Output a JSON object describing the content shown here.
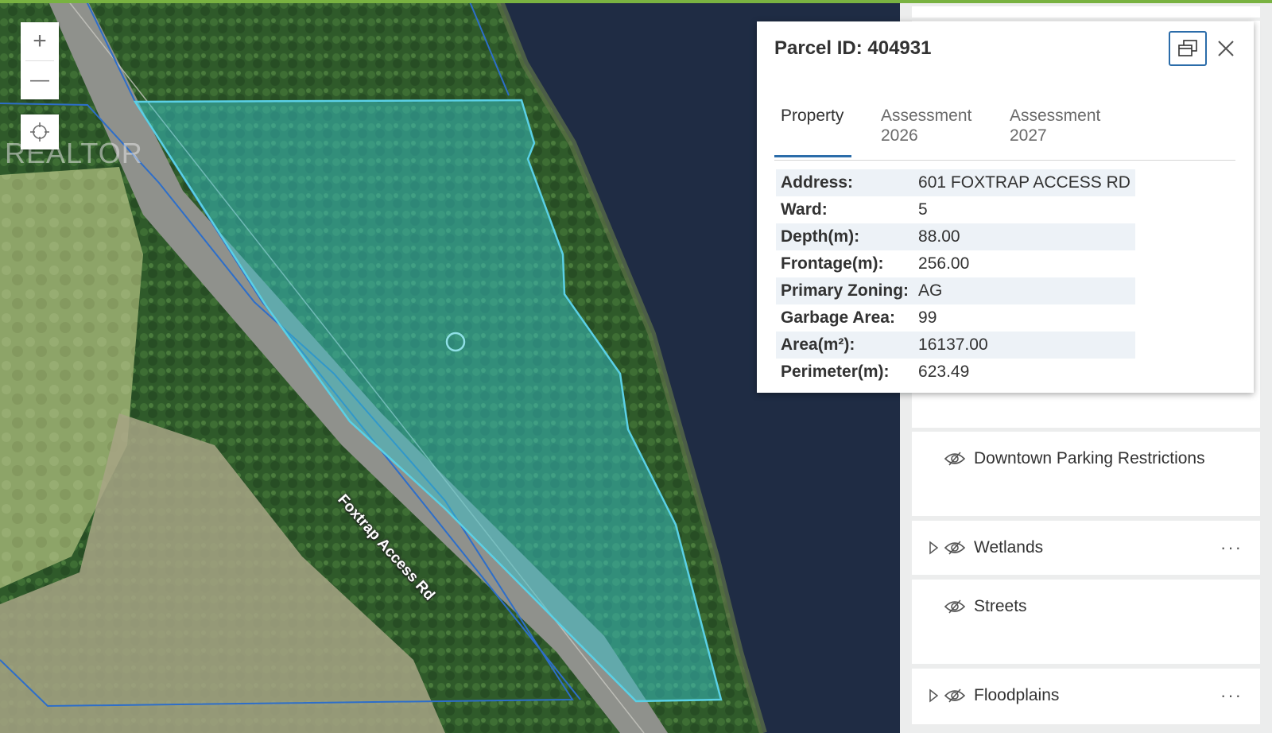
{
  "map": {
    "road_label": "Foxtrap Access Rd",
    "watermark": "REALTOR",
    "controls": {
      "zoom_in": "+",
      "zoom_out": "—"
    },
    "colors": {
      "parcel_fill": "#35c2c9",
      "parcel_outline": "#5ad0e6",
      "water": "#1f2c44",
      "boundary": "#2d6ec9"
    }
  },
  "popup": {
    "title": "Parcel ID: 404931",
    "tabs": [
      {
        "line1": "Property",
        "line2": ""
      },
      {
        "line1": "Assessment",
        "line2": "2026"
      },
      {
        "line1": "Assessment",
        "line2": "2027"
      }
    ],
    "active_tab": "Property",
    "attributes": [
      {
        "label": "Address:",
        "value": "601 FOXTRAP ACCESS RD"
      },
      {
        "label": "Ward:",
        "value": "5"
      },
      {
        "label": "Depth(m):",
        "value": "88.00"
      },
      {
        "label": "Frontage(m):",
        "value": "256.00"
      },
      {
        "label": "Primary Zoning:",
        "value": "AG"
      },
      {
        "label": "Garbage Area:",
        "value": "99"
      },
      {
        "label": "Area(m²):",
        "value": "16137.00"
      },
      {
        "label": "Perimeter(m):",
        "value": "623.49"
      }
    ],
    "icons": {
      "dock": "dock-icon",
      "close": "close-icon"
    }
  },
  "layers": [
    {
      "name": "Downtown Parking Restrictions",
      "expandable": false,
      "has_menu": false
    },
    {
      "name": "Wetlands",
      "expandable": true,
      "has_menu": true,
      "menu": "···"
    },
    {
      "name": "Streets",
      "expandable": false,
      "has_menu": false
    },
    {
      "name": "Floodplains",
      "expandable": true,
      "has_menu": true,
      "menu": "···"
    }
  ]
}
